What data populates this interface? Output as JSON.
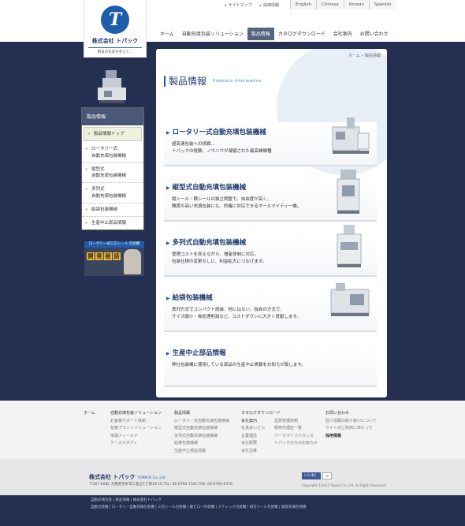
{
  "header": {
    "util_links": [
      "サイトマップ",
      "採用情報"
    ],
    "languages": [
      "English",
      "Chinese",
      "Korean",
      "Spanish"
    ],
    "logo": {
      "name": "株式会社 トパック",
      "tagline": "明日の包装を考えて…",
      "mark": "T"
    },
    "nav": [
      "ホーム",
      "自動充填包装ソリューション",
      "製品情報",
      "カタログダウンロード",
      "会社案内",
      "お問い合わせ"
    ],
    "active_nav": 2
  },
  "sidebar": {
    "heading": "製品情報",
    "items": [
      "製品情報トップ",
      "ロータリー式\n自動充填包装機械",
      "縦型式\n自動充填包装機械",
      "多列式\n自動充填包装機械",
      "給袋包装機械",
      "生産中止部品情報"
    ],
    "banner": {
      "strip": "ロータリー式三方シール 包装機",
      "kanji": [
        "開",
        "発",
        "秘",
        "話"
      ]
    }
  },
  "main": {
    "breadcrumb": {
      "home": "ホーム",
      "separator": "»",
      "current": "製品情報"
    },
    "title": "製品情報",
    "title_en": "Products Information",
    "cards": [
      {
        "title": "ロータリー式自動充填包装機械",
        "desc": [
          "超高速包装への挑戦…",
          "トパックの経験、ノウハウが凝縮された最高峰機種"
        ]
      },
      {
        "title": "縦型式自動充填包装機械",
        "desc": [
          "縦シール・横シールの独立調整で、自由度が高く、",
          "難度の高い充填包装にも、的確に対応できるオールマイティー機。"
        ]
      },
      {
        "title": "多列式自動充填包装機械",
        "desc": [
          "管理コストを抑えながら、増産体制に対応。",
          "包装仕様の変更なしに、利益拡大につなげます。"
        ]
      },
      {
        "title": "給袋包装機械",
        "desc": [
          "鉄列方式でコンパクト続装、他にはない、独自の方式で、",
          "サイズ縮小・後処理削減など、コストダウンに大きく貢献します。"
        ]
      },
      {
        "title": "生産中止部品情報",
        "desc": [
          "弊社包装機に使用している部品の生産中止情報をお知らせ致します。"
        ]
      }
    ]
  },
  "footer": {
    "columns": [
      {
        "heading": "ホーム",
        "links": []
      },
      {
        "heading": "自動充填包装ソリューション",
        "links": [
          "お客様サポート体制",
          "包装プラントソリューション",
          "液漏フィールド",
          "ケーススタディ"
        ]
      },
      {
        "heading": "製品情報",
        "links": [
          "ロータリー式自動充填包装機械",
          "縦型式自動充填包装機械",
          "多列式自動充填包装機械",
          "給袋包装機械",
          "生産中止部品情報"
        ]
      },
      {
        "heading": "カタログダウンロード",
        "links": []
      },
      {
        "heading": "会社案内",
        "links": [
          "社長あいさつ",
          "企業理念",
          "会社概要",
          "会社沿革"
        ]
      },
      {
        "heading": "",
        "links": [
          "品質管理体制",
          "販売代理店一覧",
          "ワークライフバランス",
          "トパックからのお知らせ"
        ]
      },
      {
        "heading": "お問い合わせ",
        "links": [
          "個人情報の取り扱いについて",
          "サイトのご利用にあたって"
        ],
        "bold": "採用情報"
      }
    ],
    "info": {
      "logo": "株式会社 トパック",
      "logo_sub": "TOPACK Co.,Ltd.",
      "address": "〒567-0082 大阪府茨木市三島丘1丁目19-16  TEL: 06-6792-7341 FAX: 06-6794-0376",
      "like_label": "いいね！",
      "mail_label": "✉",
      "copyright": "Copyright ©2013 Topack Co.,Ltd. All Rights Reserved."
    },
    "bottom_rows": [
      "自動充填包装 | 製品情報 | 株式会社トパック",
      "自動包装機 | ロータリー自動充填包装機 | 三方シール包装機 | 縦ピロー包装機 | スティック包装機 | 四方シール包装機 | 給袋充填包装機"
    ]
  }
}
